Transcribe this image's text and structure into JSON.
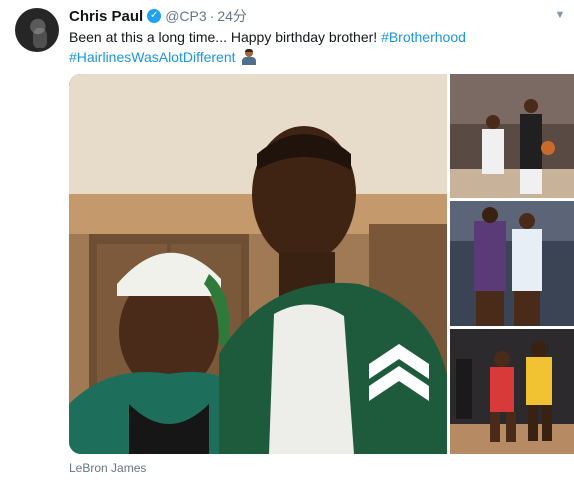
{
  "author": {
    "name": "Chris Paul",
    "handle": "@CP3",
    "separator": "·",
    "timestamp": "24分",
    "verified": true
  },
  "tweet": {
    "text": "Been at this a long time... Happy birthday brother! ",
    "hashtags": [
      "#Brotherhood",
      "#HairlinesWasAlotDifferent"
    ],
    "emoji": "man-shrugging-emoji"
  },
  "media": {
    "main_photo": "two-young-men-portrait",
    "thumbnails": [
      "basketball-game-red-white-uniforms",
      "basketball-game-purple-white-uniforms",
      "basketball-game-red-yellow-uniforms"
    ]
  },
  "caption": "LeBron James",
  "colors": {
    "link": "#1b95e0",
    "verified": "#1da1f2",
    "secondary_text": "#657786"
  }
}
